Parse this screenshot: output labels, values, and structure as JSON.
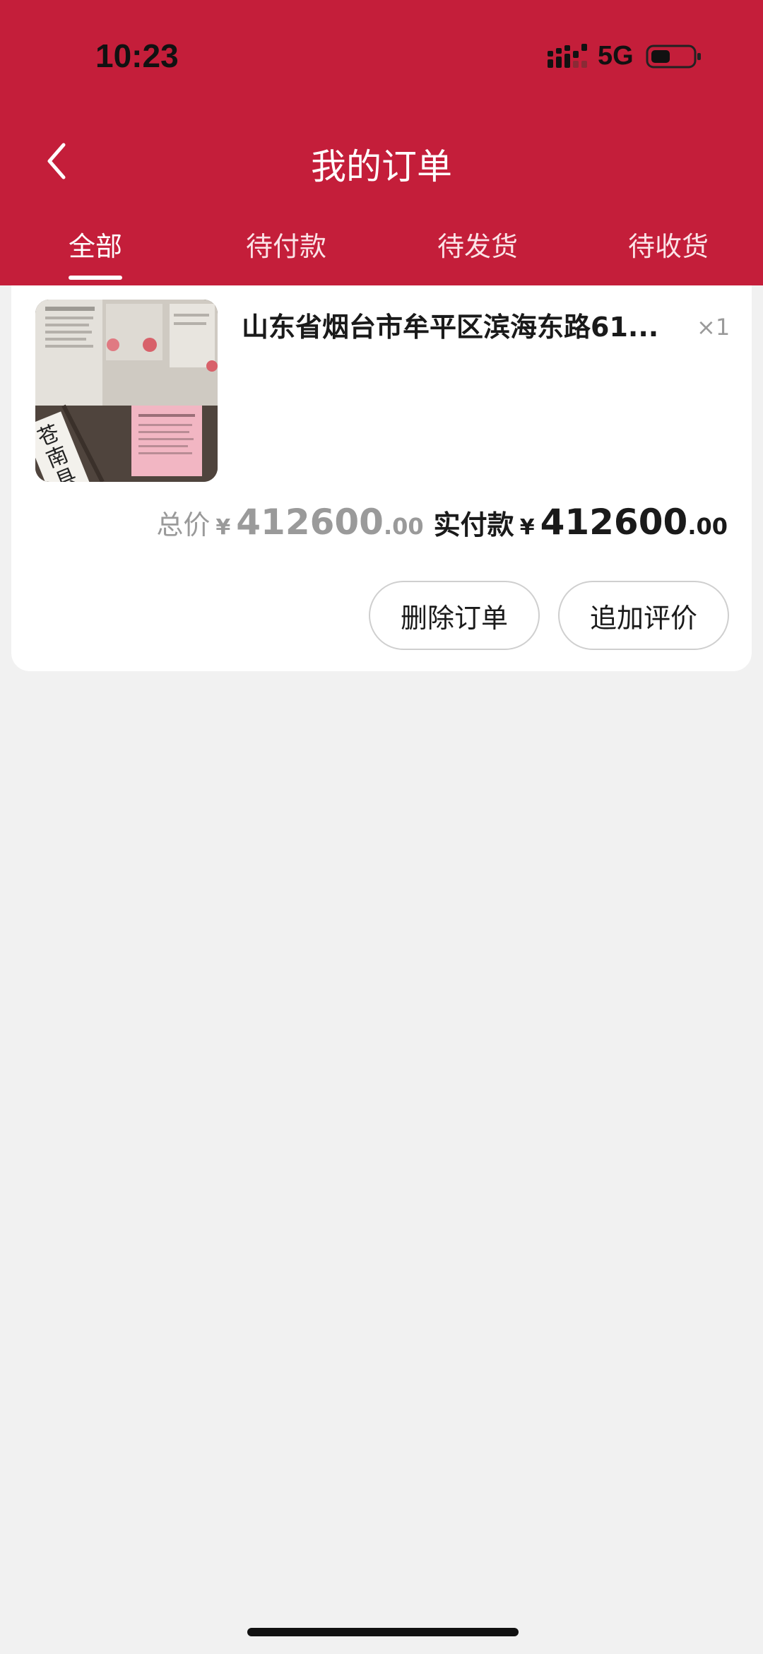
{
  "status_bar": {
    "time": "10:23",
    "network": "5G"
  },
  "header": {
    "title": "我的订单"
  },
  "tabs": [
    {
      "label": "全部",
      "active": true
    },
    {
      "label": "待付款",
      "active": false
    },
    {
      "label": "待发货",
      "active": false
    },
    {
      "label": "待收货",
      "active": false
    }
  ],
  "order": {
    "product_title": "山东省烟台市牟平区滨海东路61...",
    "quantity": "×1",
    "total_label": "总价",
    "total_currency": "¥",
    "total_int": "412600",
    "total_dec": ".00",
    "paid_label": "实付款",
    "paid_currency": "¥",
    "paid_int": "412600",
    "paid_dec": ".00",
    "thumb_sign_text": "苍南县",
    "buttons": {
      "delete": "删除订单",
      "review": "追加评价"
    }
  },
  "colors": {
    "brand_red": "#c41e3a",
    "page_bg": "#f1f1f1",
    "card_bg": "#ffffff"
  }
}
